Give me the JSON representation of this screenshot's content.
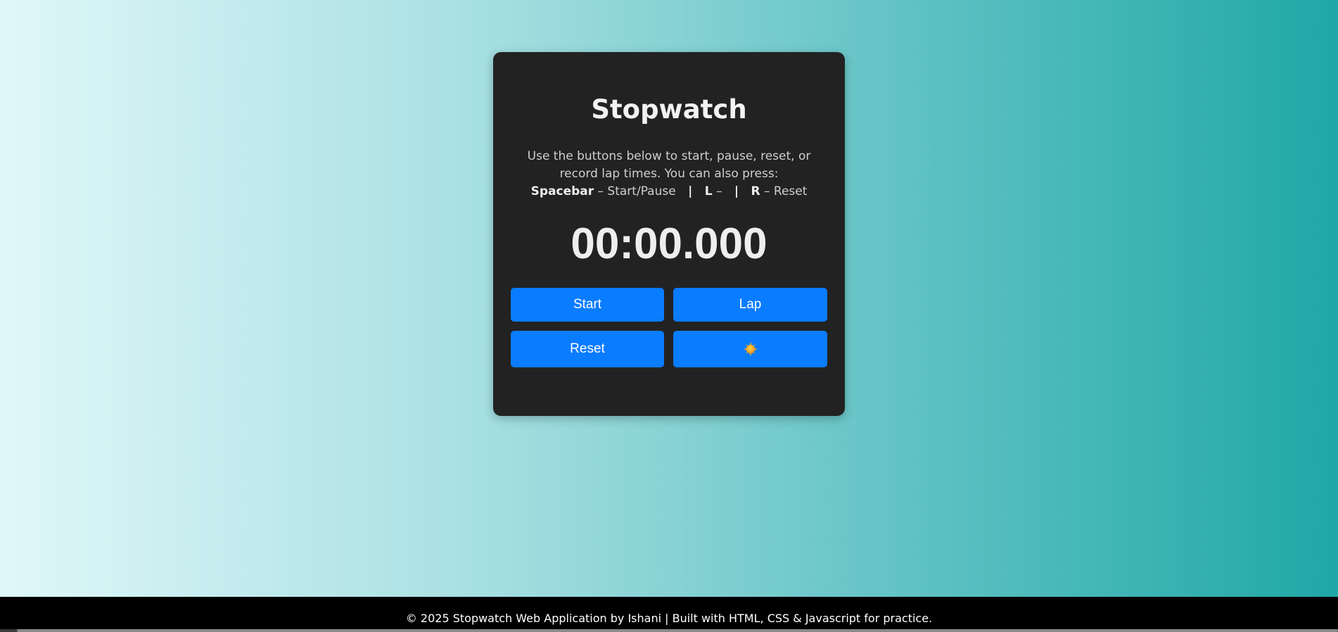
{
  "app": {
    "title": "Stopwatch"
  },
  "instructions": {
    "line1": "Use the buttons below to start, pause, reset, or record lap times. You can also press:",
    "key_space": "Spacebar",
    "key_space_desc": " – Start/Pause",
    "separator": "|",
    "key_l": "L",
    "key_l_desc": " –",
    "key_r": "R",
    "key_r_desc": " – Reset"
  },
  "timer": {
    "display": "00:00.000"
  },
  "buttons": {
    "start_label": "Start",
    "lap_label": "Lap",
    "reset_label": "Reset",
    "theme_icon": "sun-icon"
  },
  "footer": {
    "text": "© 2025 Stopwatch Web Application by Ishani | Built with HTML, CSS & Javascript for practice."
  },
  "colors": {
    "card_background": "#222222",
    "button_blue": "#0a7cff",
    "footer_background": "#000000",
    "gradient_start": "#e0f7fa",
    "gradient_end": "#1fa8a6"
  }
}
